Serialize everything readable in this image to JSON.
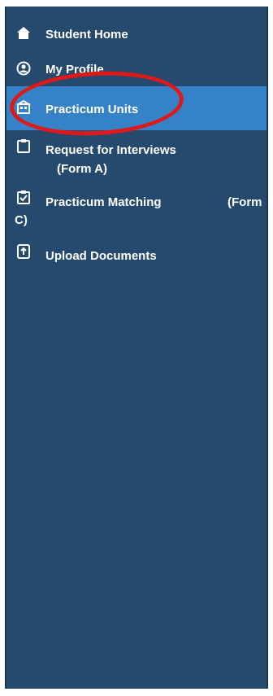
{
  "sidebar": {
    "items": [
      {
        "label": "Student Home",
        "icon": "home-icon"
      },
      {
        "label": "My Profile",
        "icon": "profile-icon"
      },
      {
        "label": "Practicum Units",
        "icon": "practicum-units-icon",
        "active": true
      },
      {
        "label": "Request for Interviews",
        "label_line2": "(Form A)",
        "icon": "clipboard-icon"
      },
      {
        "label": "Practicum Matching",
        "label_tail": "(Form",
        "label_line2": "C)",
        "icon": "clipboard-check-icon"
      },
      {
        "label": "Upload Documents",
        "icon": "upload-icon"
      }
    ]
  },
  "colors": {
    "sidebar_bg": "#254a6e",
    "active_bg": "#3682c8",
    "annotation": "#e01818"
  }
}
